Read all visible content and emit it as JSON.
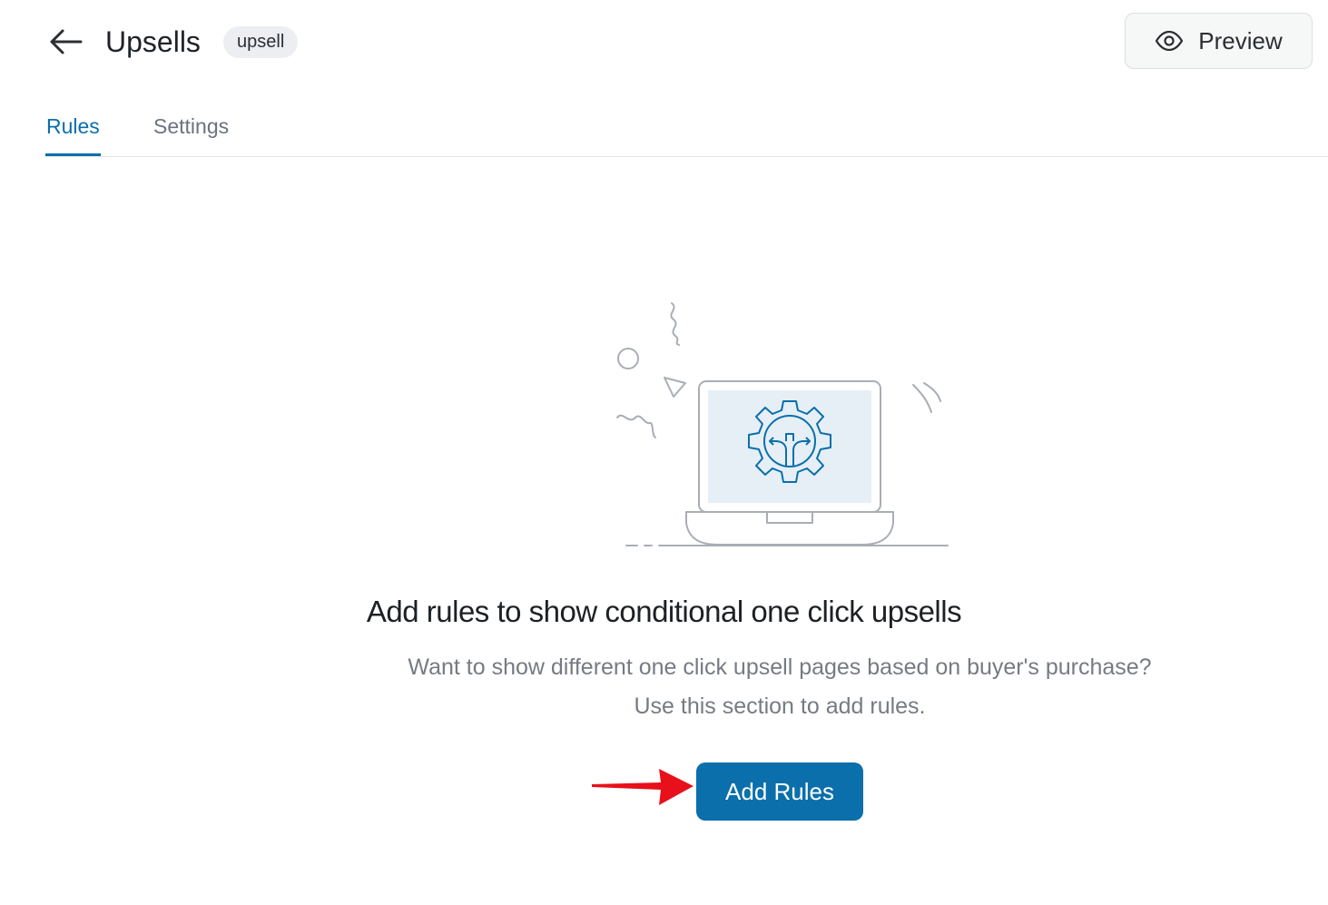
{
  "header": {
    "back_icon": "arrow-left-icon",
    "title": "Upsells",
    "badge": "upsell",
    "preview_icon": "eye-icon",
    "preview_label": "Preview"
  },
  "tabs": [
    {
      "label": "Rules",
      "active": true
    },
    {
      "label": "Settings",
      "active": false
    }
  ],
  "empty_state": {
    "illustration": "laptop-gear-icon",
    "title": "Add rules to show conditional one click upsells",
    "description_line1": "Want to show different one click upsell pages based on buyer's purchase?",
    "description_line2": "Use this section to add rules.",
    "button_label": "Add Rules"
  },
  "annotation": {
    "arrow": "red-pointer-arrow-icon",
    "color": "#e8101a"
  },
  "colors": {
    "accent": "#0a6fab",
    "muted_text": "#767b82"
  }
}
